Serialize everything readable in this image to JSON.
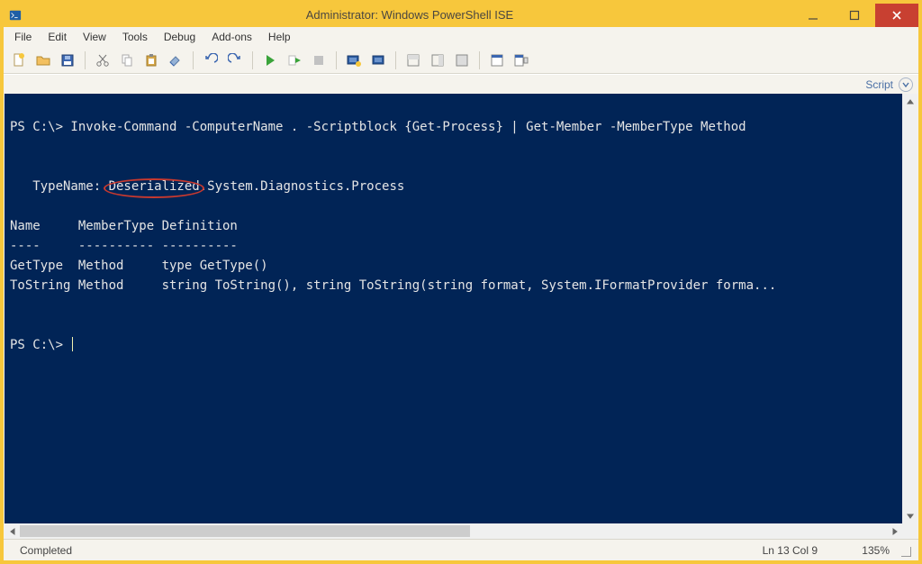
{
  "window": {
    "title": "Administrator: Windows PowerShell ISE"
  },
  "menu": {
    "file": "File",
    "edit": "Edit",
    "view": "View",
    "tools": "Tools",
    "debug": "Debug",
    "addons": "Add-ons",
    "help": "Help"
  },
  "scriptbar": {
    "label": "Script"
  },
  "console": {
    "line1": "PS C:\\> Invoke-Command -ComputerName . -Scriptblock {Get-Process} | Get-Member -MemberType Method",
    "blank": "",
    "typename_label": "   TypeName: ",
    "typename_highlight": "Deserialized",
    "typename_rest": ".System.Diagnostics.Process",
    "header": "Name     MemberType Definition",
    "rule": "----     ---------- ----------",
    "row1": "GetType  Method     type GetType()",
    "row2": "ToString Method     string ToString(), string ToString(string format, System.IFormatProvider forma...",
    "prompt2": "PS C:\\> "
  },
  "status": {
    "left": "Completed",
    "position": "Ln 13  Col 9",
    "zoom": "135%"
  }
}
